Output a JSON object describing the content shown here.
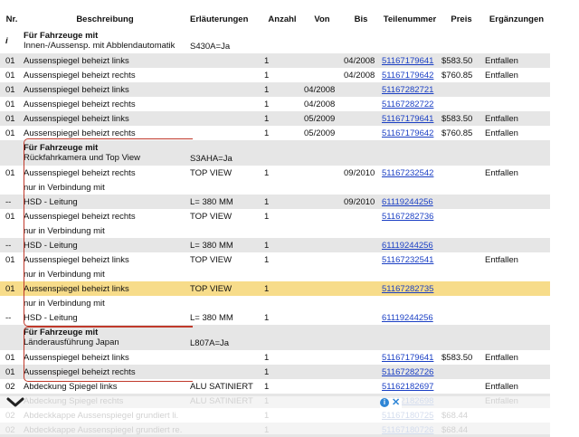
{
  "headers": {
    "nr": "Nr.",
    "beschreibung": "Beschreibung",
    "erlaeuterungen": "Erläuterungen",
    "anzahl": "Anzahl",
    "von": "Von",
    "bis": "Bis",
    "teilenummer": "Teilenummer",
    "preis": "Preis",
    "ergaenzungen": "Ergänzungen"
  },
  "groups": [
    {
      "nr": "i",
      "title": "Für Fahrzeuge mit",
      "subtitle": "Innen-/Aussensp. mit Abblendautomatik",
      "note": "S430A=Ja"
    },
    {
      "nr": "",
      "title": "Für Fahrzeuge mit",
      "subtitle": "Rückfahrkamera und Top View",
      "note": "S3AHA=Ja"
    },
    {
      "nr": "",
      "title": "Für Fahrzeuge mit",
      "subtitle": "Länderausführung Japan",
      "note": "L807A=Ja"
    }
  ],
  "rows": [
    {
      "nr": "01",
      "desc": "Aussenspiegel beheizt links",
      "erl": "",
      "anz": "1",
      "von": "",
      "bis": "04/2008",
      "part": "51167179641",
      "price": "$583.50",
      "erg": "Entfallen"
    },
    {
      "nr": "01",
      "desc": "Aussenspiegel beheizt rechts",
      "erl": "",
      "anz": "1",
      "von": "",
      "bis": "04/2008",
      "part": "51167179642",
      "price": "$760.85",
      "erg": "Entfallen"
    },
    {
      "nr": "01",
      "desc": "Aussenspiegel beheizt links",
      "erl": "",
      "anz": "1",
      "von": "04/2008",
      "bis": "",
      "part": "51167282721",
      "price": "",
      "erg": ""
    },
    {
      "nr": "01",
      "desc": "Aussenspiegel beheizt rechts",
      "erl": "",
      "anz": "1",
      "von": "04/2008",
      "bis": "",
      "part": "51167282722",
      "price": "",
      "erg": ""
    },
    {
      "nr": "01",
      "desc": "Aussenspiegel beheizt links",
      "erl": "",
      "anz": "1",
      "von": "05/2009",
      "bis": "",
      "part": "51167179641",
      "price": "$583.50",
      "erg": "Entfallen"
    },
    {
      "nr": "01",
      "desc": "Aussenspiegel beheizt rechts",
      "erl": "",
      "anz": "1",
      "von": "05/2009",
      "bis": "",
      "part": "51167179642",
      "price": "$760.85",
      "erg": "Entfallen"
    },
    {
      "nr": "01",
      "desc": "Aussenspiegel beheizt rechts",
      "erl": "TOP VIEW",
      "anz": "1",
      "von": "",
      "bis": "09/2010",
      "part": "51167232542",
      "price": "",
      "erg": "Entfallen"
    },
    {
      "nr": "",
      "desc": "nur in Verbindung mit",
      "erl": "",
      "anz": "",
      "von": "",
      "bis": "",
      "part": "",
      "price": "",
      "erg": ""
    },
    {
      "nr": "--",
      "desc": "HSD - Leitung",
      "erl": "L= 380 MM",
      "anz": "1",
      "von": "",
      "bis": "09/2010",
      "part": "61119244256",
      "price": "",
      "erg": ""
    },
    {
      "nr": "01",
      "desc": "Aussenspiegel beheizt rechts",
      "erl": "TOP VIEW",
      "anz": "1",
      "von": "",
      "bis": "",
      "part": "51167282736",
      "price": "",
      "erg": ""
    },
    {
      "nr": "",
      "desc": "nur in Verbindung mit",
      "erl": "",
      "anz": "",
      "von": "",
      "bis": "",
      "part": "",
      "price": "",
      "erg": ""
    },
    {
      "nr": "--",
      "desc": "HSD - Leitung",
      "erl": "L= 380 MM",
      "anz": "1",
      "von": "",
      "bis": "",
      "part": "61119244256",
      "price": "",
      "erg": ""
    },
    {
      "nr": "01",
      "desc": "Aussenspiegel beheizt links",
      "erl": "TOP VIEW",
      "anz": "1",
      "von": "",
      "bis": "",
      "part": "51167232541",
      "price": "",
      "erg": "Entfallen"
    },
    {
      "nr": "",
      "desc": "nur in Verbindung mit",
      "erl": "",
      "anz": "",
      "von": "",
      "bis": "",
      "part": "",
      "price": "",
      "erg": ""
    },
    {
      "nr": "01",
      "desc": "Aussenspiegel beheizt links",
      "erl": "TOP VIEW",
      "anz": "1",
      "von": "",
      "bis": "",
      "part": "51167282735",
      "price": "",
      "erg": ""
    },
    {
      "nr": "",
      "desc": "nur in Verbindung mit",
      "erl": "",
      "anz": "",
      "von": "",
      "bis": "",
      "part": "",
      "price": "",
      "erg": ""
    },
    {
      "nr": "--",
      "desc": "HSD - Leitung",
      "erl": "L= 380 MM",
      "anz": "1",
      "von": "",
      "bis": "",
      "part": "61119244256",
      "price": "",
      "erg": ""
    },
    {
      "nr": "01",
      "desc": "Aussenspiegel beheizt links",
      "erl": "",
      "anz": "1",
      "von": "",
      "bis": "",
      "part": "51167179641",
      "price": "$583.50",
      "erg": "Entfallen"
    },
    {
      "nr": "01",
      "desc": "Aussenspiegel beheizt rechts",
      "erl": "",
      "anz": "1",
      "von": "",
      "bis": "",
      "part": "51167282726",
      "price": "",
      "erg": ""
    },
    {
      "nr": "02",
      "desc": "Abdeckung Spiegel links",
      "erl": "ALU SATINIERT",
      "anz": "1",
      "von": "",
      "bis": "",
      "part": "51162182697",
      "price": "",
      "erg": "Entfallen"
    },
    {
      "nr": "",
      "desc": "Abdeckung Spiegel rechts",
      "erl": "ALU SATINIERT",
      "anz": "1",
      "von": "",
      "bis": "",
      "part": "51162182698",
      "price": "",
      "erg": "Entfallen"
    },
    {
      "nr": "02",
      "desc": "Abdeckkappe Aussenspiegel grundiert li.",
      "erl": "",
      "anz": "1",
      "von": "",
      "bis": "",
      "part": "51167180725",
      "price": "$68.44",
      "erg": ""
    },
    {
      "nr": "02",
      "desc": "Abdeckkappe Aussenspiegel grundiert re.",
      "erl": "",
      "anz": "1",
      "von": "",
      "bis": "",
      "part": "51167180726",
      "price": "$68.44",
      "erg": ""
    }
  ],
  "ad_info_glyph": "i",
  "ad_close_glyph": "✕",
  "colors": {
    "link": "#1a3fc4",
    "highlight": "#f7dc8a",
    "bracket": "#c0392b",
    "row_grey": "#e6e6e6"
  }
}
